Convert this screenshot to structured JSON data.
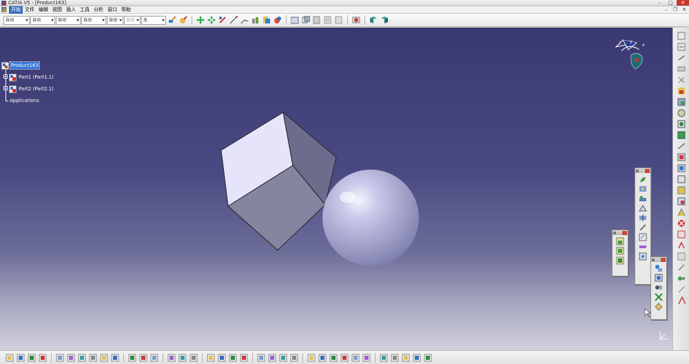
{
  "window": {
    "title": "CATIA V5 - [Product163]",
    "controls": [
      "minimize",
      "maximize",
      "close"
    ]
  },
  "menu": {
    "items": [
      {
        "label": "开始",
        "active": true
      },
      {
        "label": "文件"
      },
      {
        "label": "编辑"
      },
      {
        "label": "视图"
      },
      {
        "label": "插入"
      },
      {
        "label": "工具"
      },
      {
        "label": "分析"
      },
      {
        "label": "窗口"
      },
      {
        "label": "帮助"
      }
    ]
  },
  "graphic_toolbar": {
    "combos": [
      {
        "value": "自动",
        "enabled": true
      },
      {
        "value": "自动",
        "enabled": true
      },
      {
        "value": "自动",
        "enabled": true
      },
      {
        "value": "自动",
        "enabled": true
      },
      {
        "value": "自动",
        "enabled": true
      },
      {
        "value": "自动",
        "enabled": false
      },
      {
        "value": "无",
        "enabled": true
      }
    ],
    "icons": [
      "paint-brush-icon",
      "apply-material-icon",
      "pan-icon",
      "rotate-icon",
      "snap-icon",
      "measure-between-icon",
      "measure-item-icon",
      "inertia-icon",
      "catalog-icon",
      "properties-icon",
      "bom-icon",
      "copy-icon",
      "paste-icon",
      "clash-icon",
      "section-icon",
      "plane-icon"
    ]
  },
  "spec_tree": {
    "root": {
      "label": "Product163",
      "selected": true
    },
    "children": [
      {
        "label": "Part1 (Part1.1)"
      },
      {
        "label": "Part2 (Part2.1)"
      }
    ],
    "applications_label": "Applications"
  },
  "compass": {
    "axes": [
      "x",
      "y",
      "z"
    ]
  },
  "colors": {
    "viewport_top": "#3a3870",
    "viewport_bottom": "#d0d0dc",
    "shape_face_light": "#e4e4fa",
    "shape_face_mid": "#8e8eb0",
    "shape_face_dark": "#6c6c8e",
    "sphere": "#b4b4dc",
    "tree_selection": "#3377dd"
  },
  "floating_toolbars": [
    {
      "name": "assembly-features-toolbar",
      "icons": [
        "assembly-split-icon",
        "assembly-hole-icon",
        "assembly-pocket-icon",
        "assembly-remove-icon",
        "assembly-add-icon",
        "assembly-symmetry-icon",
        "sketch-icon",
        "measure-icon"
      ]
    },
    {
      "name": "product-structure-toolbar",
      "icons": [
        "new-component-icon",
        "new-product-icon",
        "new-part-icon"
      ]
    },
    {
      "name": "constraints-toolbar",
      "icons": [
        "coincidence-icon",
        "contact-icon",
        "offset-icon",
        "angle-icon",
        "fix-icon"
      ]
    }
  ],
  "right_toolbar": {
    "icons": [
      "product-icon",
      "component-icon",
      "move-icon",
      "snap-icon",
      "explode-icon",
      "manipulate-icon",
      "catalog-browser-icon",
      "scene-icon",
      "exploded-view-icon",
      "constraint-icon",
      "fix-together-icon",
      "update-icon",
      "reorder-icon",
      "replace-icon",
      "save-management-icon",
      "multi-instantiate-icon",
      "publication-icon",
      "annotation-icon",
      "delete-icon",
      "generate-numbering-icon",
      "bill-of-material-icon",
      "clash-analysis-icon",
      "distance-icon",
      "sectioning-icon"
    ]
  },
  "bottom_toolbar": {
    "icons": [
      "new-icon",
      "open-icon",
      "save-icon",
      "print-icon",
      "cut-icon",
      "copy-icon",
      "paste-icon",
      "undo-icon",
      "redo-icon",
      "whats-this-icon",
      "formula-icon",
      "comment-icon",
      "publication-icon",
      "fly-icon",
      "fit-all-icon",
      "pan-icon",
      "rotate-icon",
      "zoom-in-icon",
      "zoom-out-icon",
      "normal-view-icon",
      "iso-view-icon",
      "shading-icon",
      "hide-show-icon",
      "swap-visible-icon",
      "tools-palette-icon",
      "update-icon",
      "catalog-icon",
      "material-icon",
      "measure-icon",
      "clash-icon",
      "knowledge-icon",
      "manipulate-icon",
      "split-icon",
      "mirror-icon",
      "analysis-icon"
    ]
  }
}
